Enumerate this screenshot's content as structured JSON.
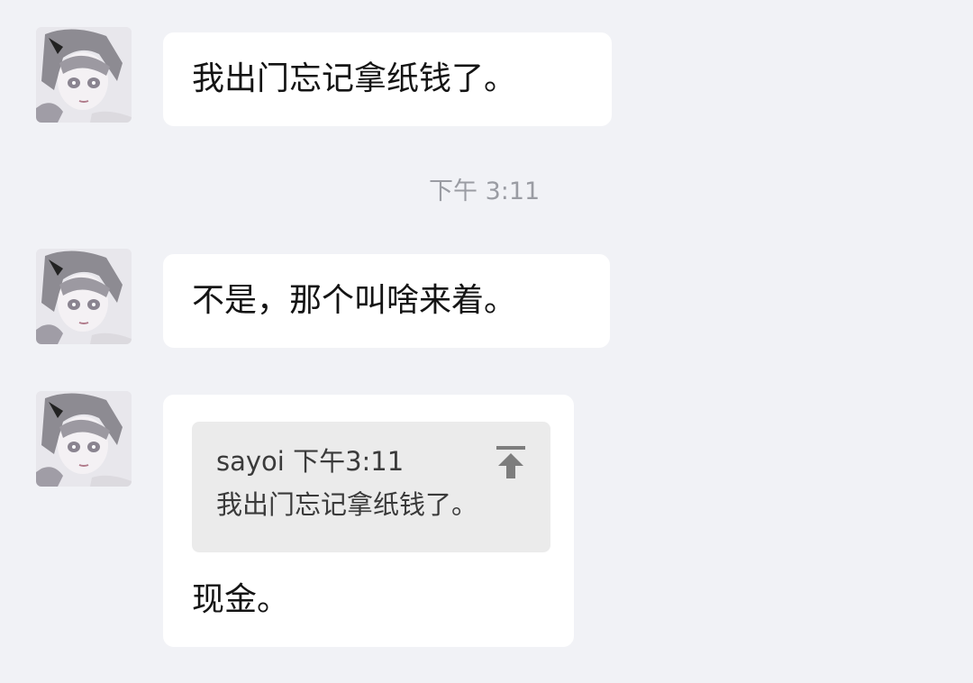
{
  "messages": [
    {
      "sender_avatar": "anime-girl-avatar",
      "text": "我出门忘记拿纸钱了。"
    },
    {
      "sender_avatar": "anime-girl-avatar",
      "text": "不是，那个叫啥来着。"
    },
    {
      "sender_avatar": "anime-girl-avatar",
      "quote": {
        "sender": "sayoi",
        "time": "下午3:11",
        "text": "我出门忘记拿纸钱了。",
        "jump_icon": "jump-to-top-icon"
      },
      "text": "现金。"
    }
  ],
  "timestamp": "下午 3:11",
  "colors": {
    "background": "#f1f2f6",
    "bubble": "#ffffff",
    "quote_background": "#ebebeb",
    "timestamp": "#9a9ca3"
  }
}
